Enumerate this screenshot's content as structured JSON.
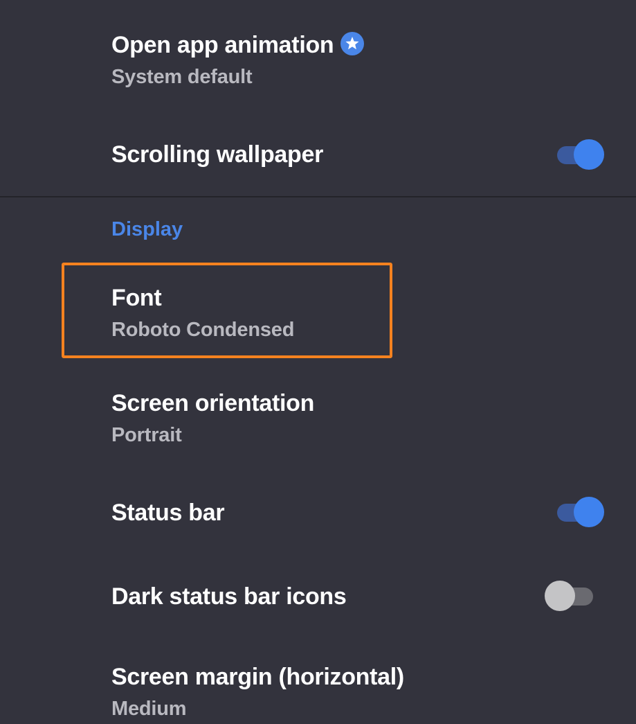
{
  "settings": {
    "open_app_animation": {
      "title": "Open app animation",
      "value": "System default",
      "badge_icon": "star-icon"
    },
    "scrolling_wallpaper": {
      "title": "Scrolling wallpaper",
      "enabled": true
    },
    "display_section": {
      "header": "Display"
    },
    "font": {
      "title": "Font",
      "value": "Roboto Condensed",
      "highlighted": true
    },
    "screen_orientation": {
      "title": "Screen orientation",
      "value": "Portrait"
    },
    "status_bar": {
      "title": "Status bar",
      "enabled": true
    },
    "dark_status_bar_icons": {
      "title": "Dark status bar icons",
      "enabled": false
    },
    "screen_margin": {
      "title": "Screen margin (horizontal)",
      "value": "Medium"
    }
  },
  "colors": {
    "background": "#33333d",
    "accent": "#4a86e8",
    "highlight": "#f5821f",
    "primary_text": "#ffffff",
    "secondary_text": "#b9b9c0"
  }
}
